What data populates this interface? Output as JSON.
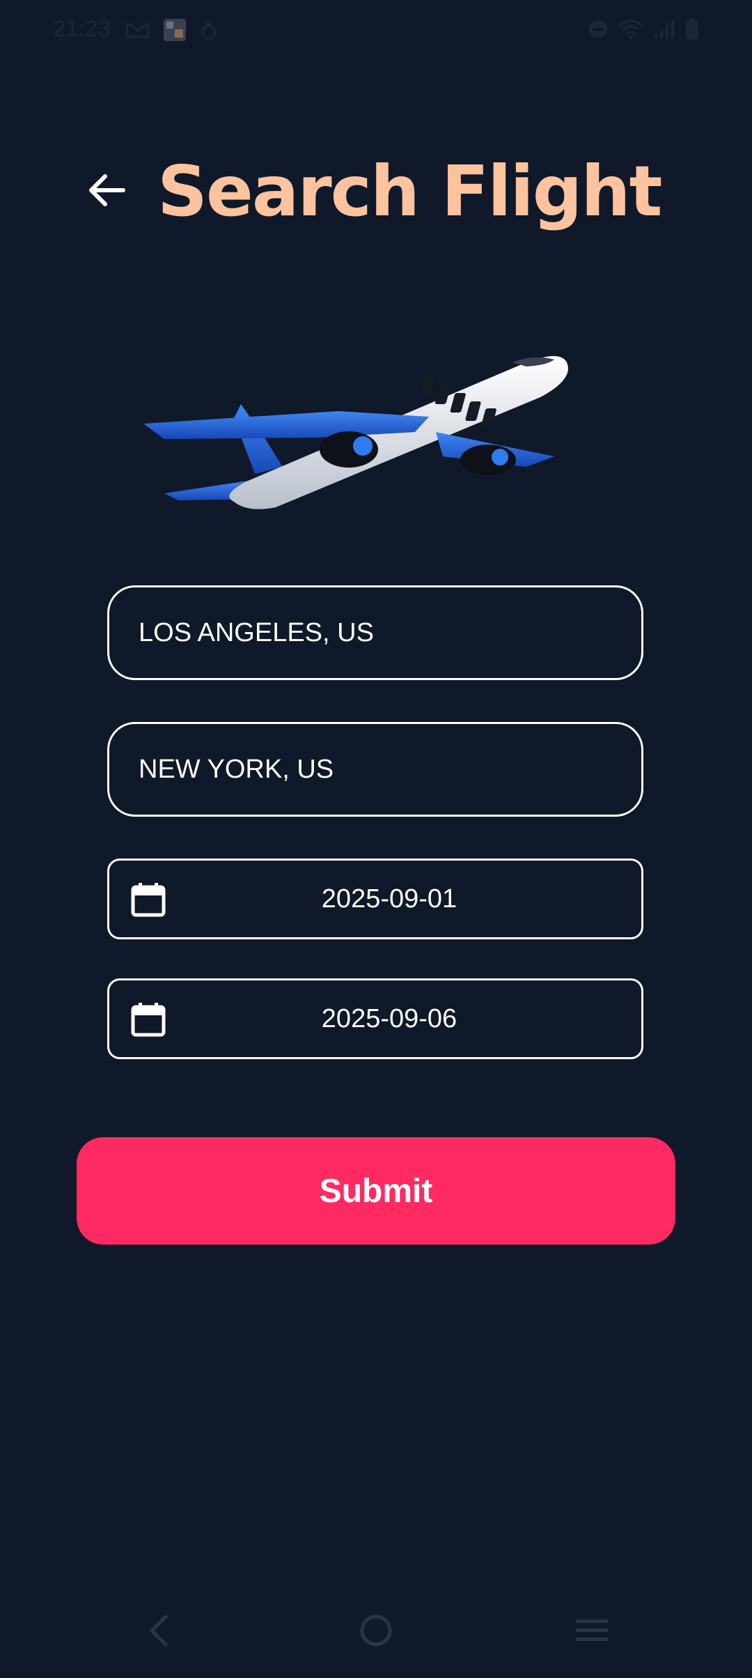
{
  "status_bar": {
    "time": "21:23",
    "left_icons": [
      "gmail-icon",
      "photo-thumbnail-icon",
      "notification-icon"
    ],
    "right_icons": [
      "dnd-icon",
      "wifi-icon",
      "signal-icon",
      "battery-icon"
    ]
  },
  "header": {
    "title": "Search Flight",
    "back_icon": "arrow-left-icon"
  },
  "form": {
    "origin": "LOS ANGELES, US",
    "destination": "NEW YORK, US",
    "departure_date": "2025-09-01",
    "return_date": "2025-09-06",
    "calendar_icon": "calendar-icon",
    "submit_label": "Submit"
  },
  "colors": {
    "background": "#0f1929",
    "title": "#fcc39e",
    "submit": "#ff2a61",
    "field_border": "#ffffff"
  },
  "nav_bar": {
    "icons": [
      "nav-back-icon",
      "nav-home-icon",
      "nav-menu-icon"
    ]
  }
}
